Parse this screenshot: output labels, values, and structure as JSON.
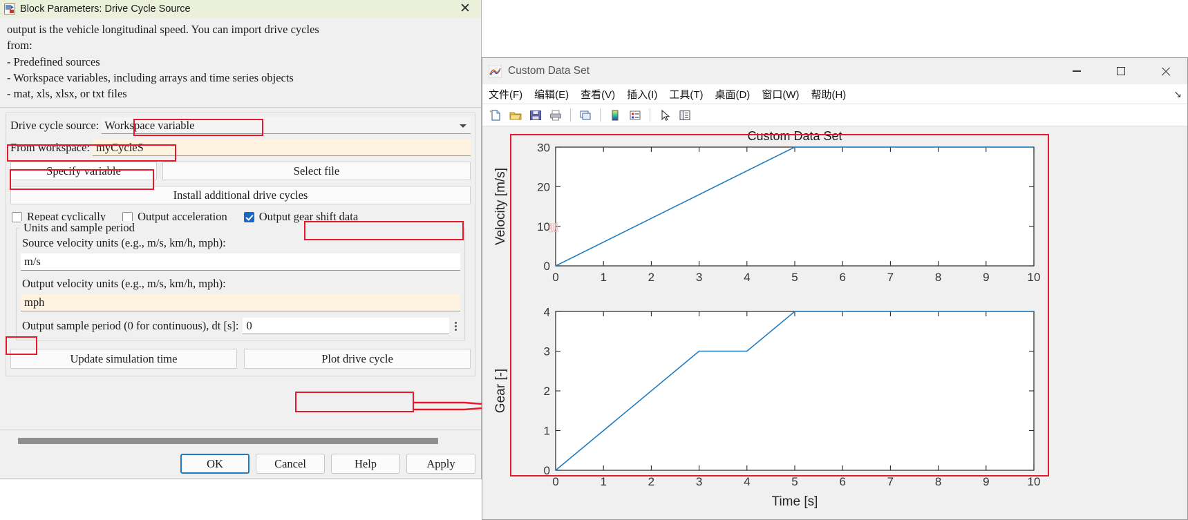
{
  "block_dialog": {
    "title": "Block Parameters: Drive Cycle Source",
    "title_icon": "block-parameters-icon",
    "close_label": "✕",
    "description": "output is the vehicle longitudinal speed. You can import drive cycles\nfrom:\n- Predefined sources\n- Workspace variables, including arrays and time series objects\n- mat, xls, xlsx, or txt files",
    "drive_cycle_source_label": "Drive cycle source:",
    "drive_cycle_source_value": "Workspace variable",
    "from_workspace_label": "From workspace:",
    "from_workspace_value": "myCycleS",
    "specify_variable_label": "Specify variable",
    "select_file_label": "Select file",
    "install_additional_label": "Install additional drive cycles",
    "checkboxes": [
      {
        "label": "Repeat cyclically",
        "checked": false
      },
      {
        "label": "Output acceleration",
        "checked": false
      },
      {
        "label": "Output gear shift data",
        "checked": true
      }
    ],
    "units_group_legend": "Units and sample period",
    "source_velocity_units_label": "Source velocity units (e.g., m/s, km/h, mph):",
    "source_velocity_units_value": "m/s",
    "output_velocity_units_label": "Output velocity units (e.g., m/s, km/h, mph):",
    "output_velocity_units_value": "mph",
    "sample_period_label": "Output sample period (0 for continuous), dt [s]:",
    "sample_period_value": "0",
    "update_sim_time_label": "Update simulation time",
    "plot_drive_cycle_label": "Plot drive cycle",
    "footer_buttons": [
      {
        "label": "OK",
        "primary": true
      },
      {
        "label": "Cancel",
        "primary": false
      },
      {
        "label": "Help",
        "primary": false
      },
      {
        "label": "Apply",
        "primary": false
      }
    ]
  },
  "figure_window": {
    "title": "Custom Data Set",
    "title_icon": "matlab-membrane-icon",
    "window_buttons": [
      {
        "name": "minimize-button",
        "glyph": "−"
      },
      {
        "name": "maximize-button",
        "glyph": "□"
      },
      {
        "name": "close-button",
        "glyph": "✕"
      }
    ],
    "menu_items": [
      "文件(F)",
      "编辑(E)",
      "查看(V)",
      "插入(I)",
      "工具(T)",
      "桌面(D)",
      "窗口(W)",
      "帮助(H)"
    ],
    "menu_overflow_glyph": "↘",
    "toolbar_icons": [
      "new-figure-icon",
      "open-file-icon",
      "save-figure-icon",
      "print-figure-icon",
      "print-preview-icon",
      "insert-colorbar-icon",
      "insert-legend-icon",
      "edit-plot-arrow-icon",
      "show-plot-tools-icon"
    ]
  },
  "chart_data": [
    {
      "type": "line",
      "id": "velocity-plot",
      "title": "Custom Data Set",
      "xlabel": "",
      "ylabel": "Velocity [m/s]",
      "xlim": [
        0,
        10
      ],
      "ylim": [
        0,
        30
      ],
      "xticks": [
        0,
        1,
        2,
        3,
        4,
        5,
        6,
        7,
        8,
        9,
        10
      ],
      "xticklabels": [
        "0",
        "1",
        "2",
        "3",
        "4",
        "5",
        "6",
        "7",
        "8",
        "9",
        "10"
      ],
      "yticks": [
        0,
        10,
        20,
        30
      ],
      "yticklabels": [
        "0",
        "10",
        "20",
        "30"
      ],
      "grid": false,
      "line_color": "#1f7bbf",
      "series": [
        {
          "name": "velocity",
          "x": [
            0,
            5,
            10
          ],
          "y": [
            0,
            30,
            30
          ]
        }
      ]
    },
    {
      "type": "line",
      "id": "gear-plot",
      "title": "",
      "xlabel": "Time [s]",
      "ylabel": "Gear [-]",
      "xlim": [
        0,
        10
      ],
      "ylim": [
        0,
        4
      ],
      "xticks": [
        0,
        1,
        2,
        3,
        4,
        5,
        6,
        7,
        8,
        9,
        10
      ],
      "xticklabels": [
        "0",
        "1",
        "2",
        "3",
        "4",
        "5",
        "6",
        "7",
        "8",
        "9",
        "10"
      ],
      "yticks": [
        0,
        1,
        2,
        3,
        4
      ],
      "yticklabels": [
        "0",
        "1",
        "2",
        "3",
        "4"
      ],
      "grid": false,
      "line_color": "#1f7bbf",
      "series": [
        {
          "name": "gear",
          "x": [
            0,
            3,
            4,
            5,
            10
          ],
          "y": [
            0,
            3,
            3,
            4,
            4
          ]
        }
      ]
    }
  ],
  "annotations": {
    "highlight_color": "#e8182a",
    "arrow_label": "plot-drive-cycle-to-figure-arrow"
  }
}
